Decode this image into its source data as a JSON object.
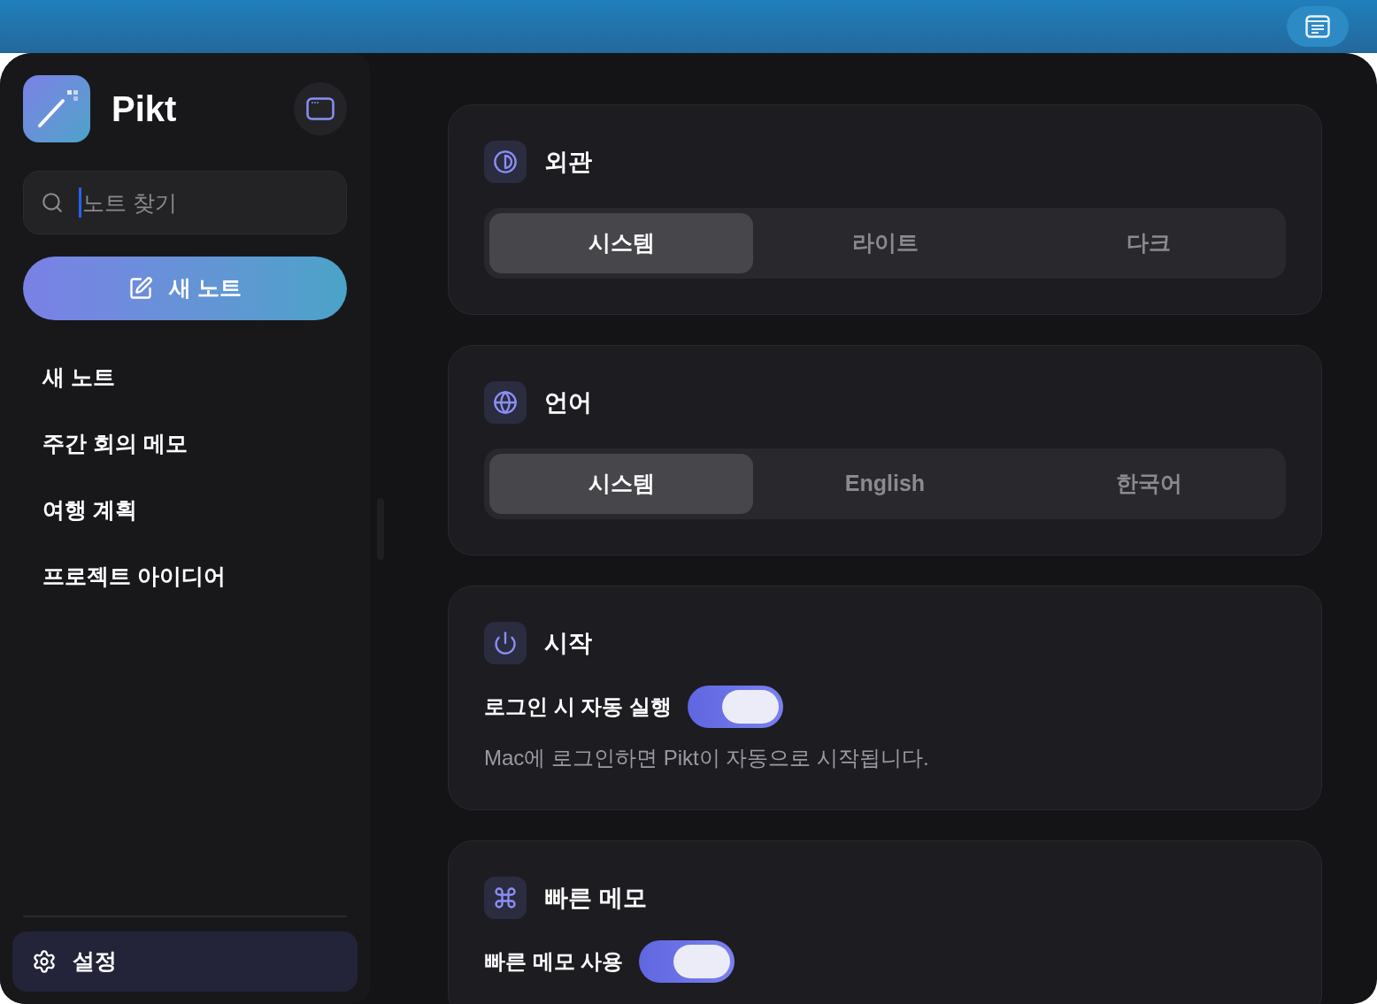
{
  "sidebar": {
    "app_name": "Pikt",
    "search": {
      "placeholder": "노트 찾기"
    },
    "new_note_button": "새 노트",
    "notes": [
      {
        "title": "새 노트",
        "selected": false
      },
      {
        "title": "주간 회의 메모",
        "selected": false
      },
      {
        "title": "여행 계획",
        "selected": false
      },
      {
        "title": "프로젝트 아이디어",
        "selected": false
      }
    ],
    "settings": {
      "label": "설정",
      "selected": true
    }
  },
  "sections": [
    {
      "kind": "segmented",
      "title": "외관",
      "options": [
        {
          "label": "시스템",
          "selected": true
        },
        {
          "label": "라이트",
          "selected": false
        },
        {
          "label": "다크",
          "selected": false
        }
      ]
    },
    {
      "kind": "segmented",
      "title": "언어",
      "options": [
        {
          "label": "시스템",
          "selected": true
        },
        {
          "label": "English",
          "selected": false
        },
        {
          "label": "한국어",
          "selected": false
        }
      ]
    },
    {
      "kind": "toggle",
      "title": "시작",
      "toggle_label": "로그인 시 자동 실행",
      "on": true,
      "description": "Mac에 로그인하면 Pikt이 자동으로 시작됩니다."
    },
    {
      "kind": "toggle",
      "title": "빠른 메모",
      "toggle_label": "빠른 메모 사용",
      "on": true
    }
  ]
}
